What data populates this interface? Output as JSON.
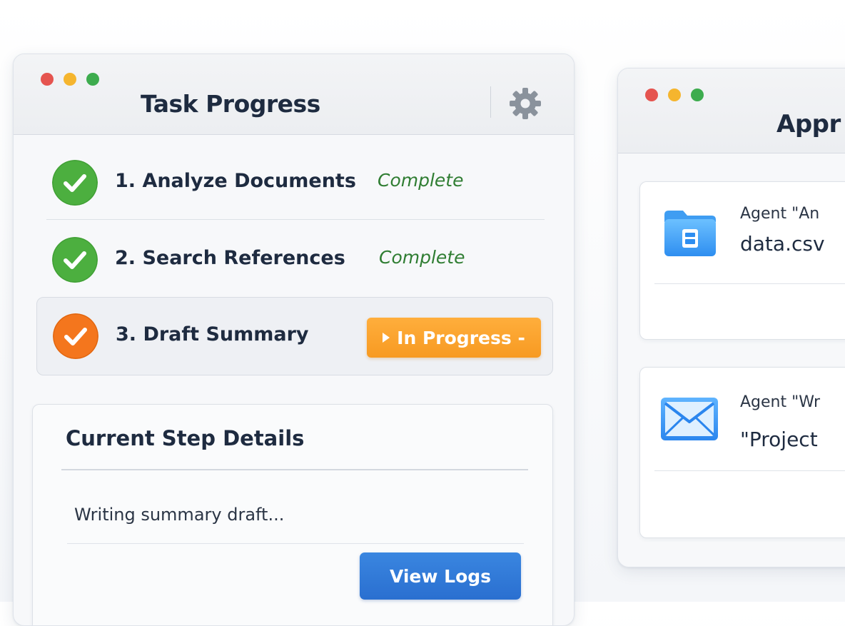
{
  "colors": {
    "traffic_red": "#e5544f",
    "traffic_yellow": "#f5b52e",
    "traffic_green": "#3dac4e",
    "complete_green": "#4caf3f",
    "in_progress_orange": "#f4761d",
    "pill_orange": "#f79a22",
    "primary_blue": "#2a6fd0",
    "complete_text": "#2f7d32"
  },
  "task_window": {
    "title": "Task Progress",
    "settings_icon": "gear-icon",
    "steps": [
      {
        "label": "1. Analyze Documents",
        "status": "Complete",
        "state": "complete",
        "icon": "check-circle-icon"
      },
      {
        "label": "2. Search References",
        "status": "Complete",
        "state": "complete",
        "icon": "check-circle-icon"
      },
      {
        "label": "3. Draft Summary",
        "status": "In Progress -",
        "state": "in-progress",
        "icon": "check-circle-icon"
      }
    ],
    "details": {
      "title": "Current Step Details",
      "text": "Writing summary draft...",
      "button_label": "View Logs"
    }
  },
  "approval_window": {
    "title": "Appr",
    "requests": [
      {
        "icon": "folder-file-icon",
        "line1": "Agent \"An",
        "line2": "data.csv"
      },
      {
        "icon": "envelope-icon",
        "line1": "Agent \"Wr",
        "line2": "\"Project"
      }
    ]
  }
}
